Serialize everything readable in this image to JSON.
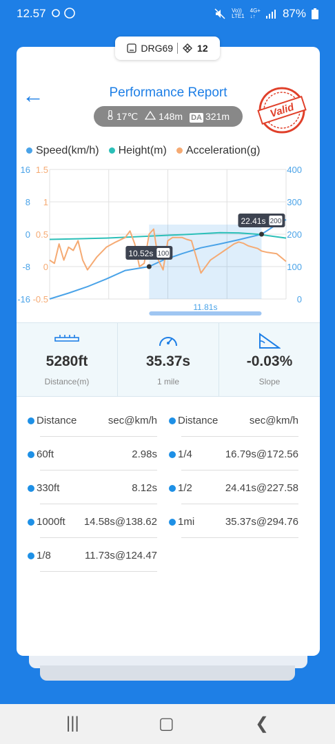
{
  "status_bar": {
    "time": "12.57",
    "lte_top": "Vo))",
    "lte_bottom": "LTE1",
    "net_top": "4G+",
    "net_bottom": "↓↑",
    "battery": "87%"
  },
  "device": {
    "name": "DRG69",
    "satellites": "12"
  },
  "header": {
    "back": "←",
    "title": "Performance Report",
    "badge": "Valid"
  },
  "conditions": {
    "temperature": "17℃",
    "altitude": "148m",
    "da_label": "DA",
    "density_altitude": "321m"
  },
  "legend": [
    {
      "label": "Speed(km/h)",
      "color": "#4aa3e8"
    },
    {
      "label": "Height(m)",
      "color": "#2bbfb8"
    },
    {
      "label": "Acceleration(g)",
      "color": "#f5aa73"
    }
  ],
  "chart_data": {
    "type": "line",
    "left_axis_1": {
      "ticks": [
        "16",
        "8",
        "0",
        "-8",
        "-16"
      ],
      "color": "#4aa3e8"
    },
    "left_axis_2": {
      "ticks": [
        "1.5",
        "1",
        "0.5",
        "0",
        "-0.5"
      ],
      "color": "#f5aa73"
    },
    "right_axis": {
      "ticks": [
        "400",
        "300",
        "200",
        "100",
        "0"
      ],
      "color": "#4aa3e8"
    },
    "ylim": [
      0,
      400
    ],
    "xlim": [
      0,
      25
    ],
    "series": [
      {
        "name": "Speed(km/h)",
        "color": "#4aa3e8",
        "x": [
          0,
          2,
          4,
          6,
          8,
          10.52,
          12,
          14,
          16,
          18,
          20,
          22.41,
          24,
          25
        ],
        "y": [
          0,
          18,
          38,
          62,
          88,
          100,
          120,
          140,
          158,
          170,
          183,
          200,
          230,
          245
        ]
      },
      {
        "name": "Height(m)",
        "color": "#2bbfb8",
        "x": [
          0,
          3,
          6,
          9,
          12,
          15,
          18,
          20,
          22,
          24,
          25
        ],
        "y": [
          184,
          186,
          188,
          192,
          196,
          200,
          205,
          204,
          200,
          192,
          188
        ]
      },
      {
        "name": "Acceleration(g)",
        "color": "#f5aa73",
        "x": [
          0,
          0.5,
          1,
          1.5,
          2,
          2.5,
          3,
          3.5,
          4,
          5,
          6,
          7,
          8,
          8.5,
          9,
          9.5,
          10,
          10.52,
          11,
          11.5,
          12,
          12.5,
          13,
          13.5,
          14,
          14.5,
          15,
          16,
          17,
          18,
          18.5,
          19,
          19.5,
          20,
          20.5,
          21,
          21.5,
          22,
          22.41,
          23,
          24,
          25
        ],
        "y": [
          0.1,
          0.05,
          0.35,
          0.1,
          0.3,
          0.25,
          0.4,
          0.1,
          -0.05,
          0.15,
          0.3,
          0.38,
          0.45,
          0.55,
          0.35,
          0.0,
          0.05,
          0.5,
          0.58,
          0.1,
          -0.05,
          0.4,
          0.45,
          0.45,
          0.45,
          0.42,
          0.4,
          -0.1,
          0.1,
          0.2,
          0.25,
          0.3,
          0.35,
          0.38,
          0.36,
          0.32,
          0.3,
          0.28,
          0.24,
          0.22,
          0.2,
          0.08
        ]
      }
    ],
    "markers": [
      {
        "x": 10.52,
        "label": "10.52s",
        "value": "100"
      },
      {
        "x": 22.41,
        "label": "22.41s",
        "value": "200"
      }
    ],
    "selection": {
      "start": 10.52,
      "end": 22.41,
      "label": "11.81s"
    }
  },
  "stats": [
    {
      "icon": "ruler-icon",
      "value": "5280ft",
      "label": "Distance(m)"
    },
    {
      "icon": "speedometer-icon",
      "value": "35.37s",
      "label": "1 mile"
    },
    {
      "icon": "slope-icon",
      "value": "-0.03%",
      "label": "Slope"
    }
  ],
  "splits": {
    "left": [
      {
        "name": "Distance",
        "value": "sec@km/h"
      },
      {
        "name": "60ft",
        "value": "2.98s"
      },
      {
        "name": "330ft",
        "value": "8.12s"
      },
      {
        "name": "1000ft",
        "value": "14.58s@138.62"
      },
      {
        "name": "1/8",
        "value": "11.73s@124.47"
      }
    ],
    "right": [
      {
        "name": "Distance",
        "value": "sec@km/h"
      },
      {
        "name": "1/4",
        "value": "16.79s@172.56"
      },
      {
        "name": "1/2",
        "value": "24.41s@227.58"
      },
      {
        "name": "1mi",
        "value": "35.37s@294.76"
      }
    ]
  },
  "navbar": {
    "recent": "|||",
    "home": "▢",
    "back": "❮"
  }
}
